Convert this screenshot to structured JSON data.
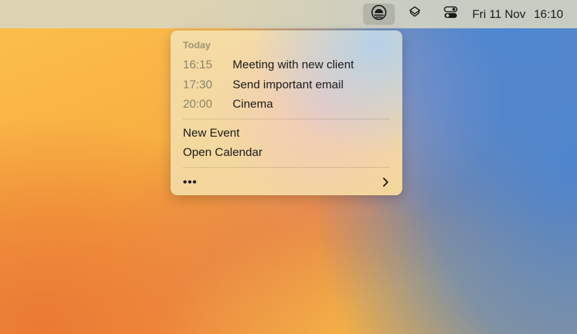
{
  "menubar": {
    "status_icons": [
      {
        "name": "calendar-sun-icon",
        "active": true
      },
      {
        "name": "layers-icon",
        "active": false
      },
      {
        "name": "control-center-icon",
        "active": false
      }
    ],
    "clock": {
      "date": "Fri 11 Nov",
      "time": "16:10"
    }
  },
  "calendar_menu": {
    "section_title": "Today",
    "events": [
      {
        "time": "16:15",
        "title": "Meeting with new client"
      },
      {
        "time": "17:30",
        "title": "Send important email"
      },
      {
        "time": "20:00",
        "title": "Cinema"
      }
    ],
    "actions": {
      "new_event": "New Event",
      "open_calendar": "Open Calendar"
    },
    "more": {
      "label": "•••",
      "icon": "chevron-right-icon"
    }
  },
  "colors": {
    "menubar_bg": "#d7d6c0",
    "wallpaper_orange": "#f7ad40",
    "wallpaper_blue": "#4f86cf",
    "section_title": "#9e9378",
    "event_time": "#8a846f"
  }
}
